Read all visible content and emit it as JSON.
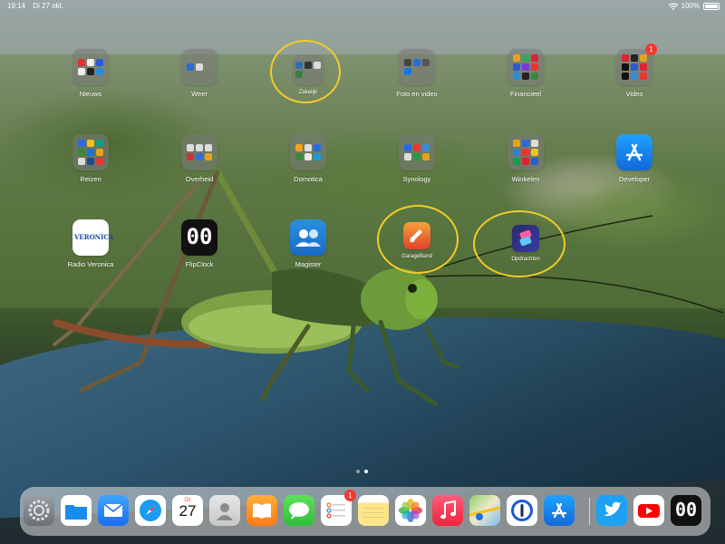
{
  "status_bar": {
    "time": "19:14",
    "date": "Di 27 okt.",
    "battery_percent": "100%"
  },
  "colors": {
    "annotation": "#f2cc2a",
    "badge": "#f03a2e"
  },
  "home_grid": {
    "row1": [
      {
        "label": "Nieuws"
      },
      {
        "label": "Weer"
      },
      {
        "label": "Zakelijk"
      },
      {
        "label": "Foto en video"
      },
      {
        "label": "Financieel"
      },
      {
        "label": "Video",
        "badge": "1"
      }
    ],
    "row2": [
      {
        "label": "Reizen"
      },
      {
        "label": "Overheid"
      },
      {
        "label": "Domotica"
      },
      {
        "label": "Synology"
      },
      {
        "label": "Winkelen"
      },
      {
        "label": "Developer"
      }
    ],
    "row3": [
      {
        "label": "Radio Veronica",
        "logo_text": "VERONICA"
      },
      {
        "label": "FlipClock",
        "glyph": "00"
      },
      {
        "label": "Magister"
      },
      {
        "label": "GarageBand"
      },
      {
        "label": "Opdrachten"
      }
    ]
  },
  "dock": {
    "calendar": {
      "weekday": "DI",
      "day": "27"
    },
    "reminders_badge": "1",
    "flipclock_glyph": "00",
    "apps": [
      "Instellingen",
      "Bestanden",
      "Mail",
      "Safari",
      "Agenda",
      "Contacten",
      "Boeken",
      "Berichten",
      "Herinneringen",
      "Notities",
      "Foto's",
      "Muziek",
      "Kaarten",
      "1Password",
      "App Store",
      "Twitter",
      "YouTube",
      "FlipClock"
    ]
  }
}
